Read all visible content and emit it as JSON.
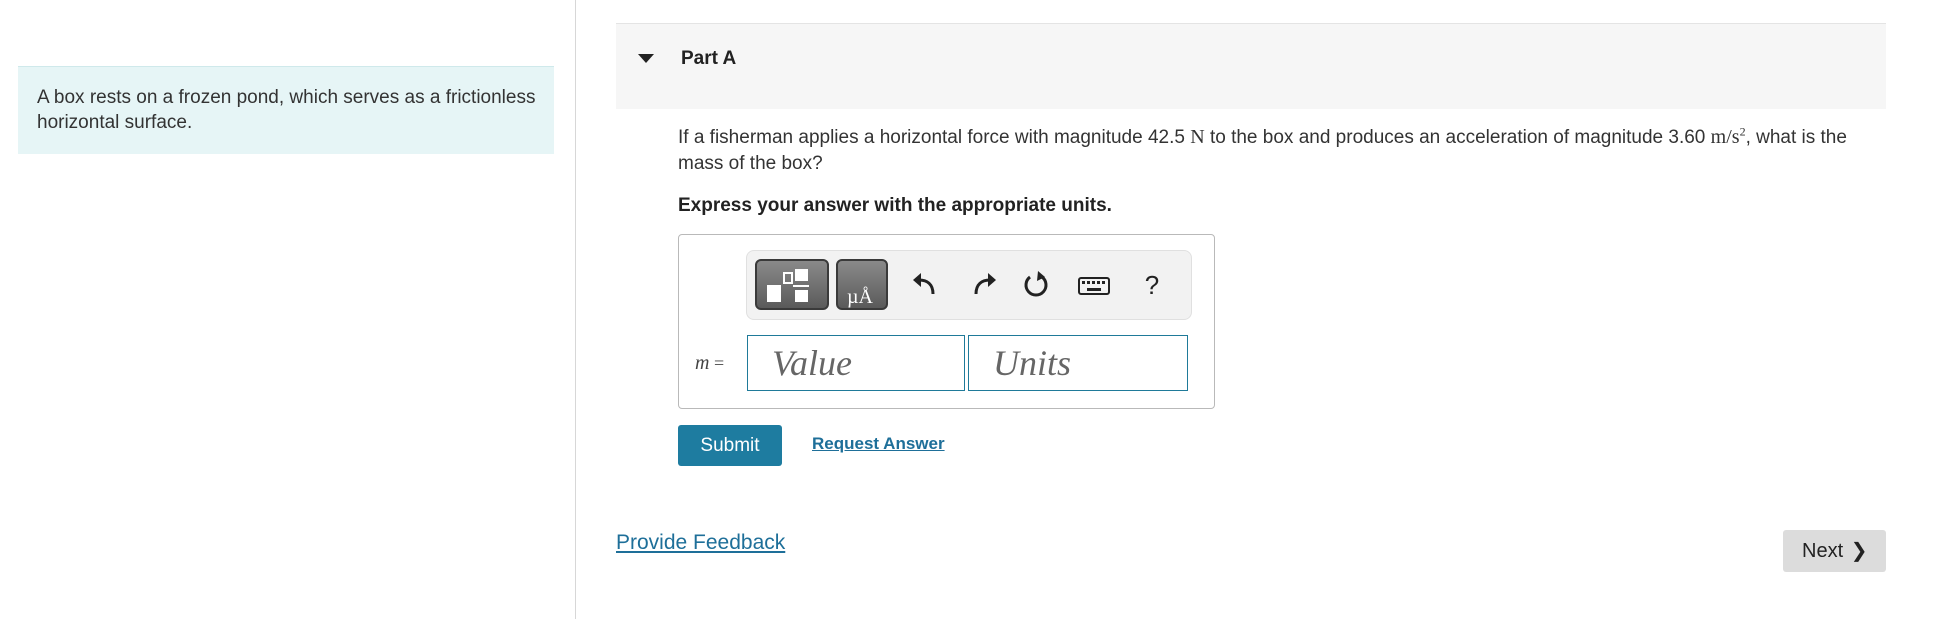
{
  "intro": {
    "text": "A box rests on a frozen pond, which serves as a frictionless horizontal surface."
  },
  "part": {
    "title": "Part A",
    "question_pre": "If a fisherman applies a horizontal force with magnitude 42.5 ",
    "force_unit": "N",
    "question_mid": " to the box and produces an acceleration of magnitude 3.60 ",
    "accel_unit": "m/s",
    "accel_exp": "2",
    "question_post": ", what is the mass of the box?",
    "instruction": "Express your answer with the appropriate units."
  },
  "answer": {
    "variable": "m",
    "equals": "=",
    "value_placeholder": "Value",
    "units_placeholder": "Units",
    "toolbar": {
      "icons": [
        "templates-icon",
        "units-symbols-icon",
        "undo-icon",
        "redo-icon",
        "reset-icon",
        "keyboard-icon",
        "help-icon"
      ],
      "help_label": "?",
      "units_label": "µÅ"
    }
  },
  "actions": {
    "submit_label": "Submit",
    "request_answer_label": "Request Answer",
    "feedback_label": "Provide Feedback",
    "next_label": "Next"
  }
}
